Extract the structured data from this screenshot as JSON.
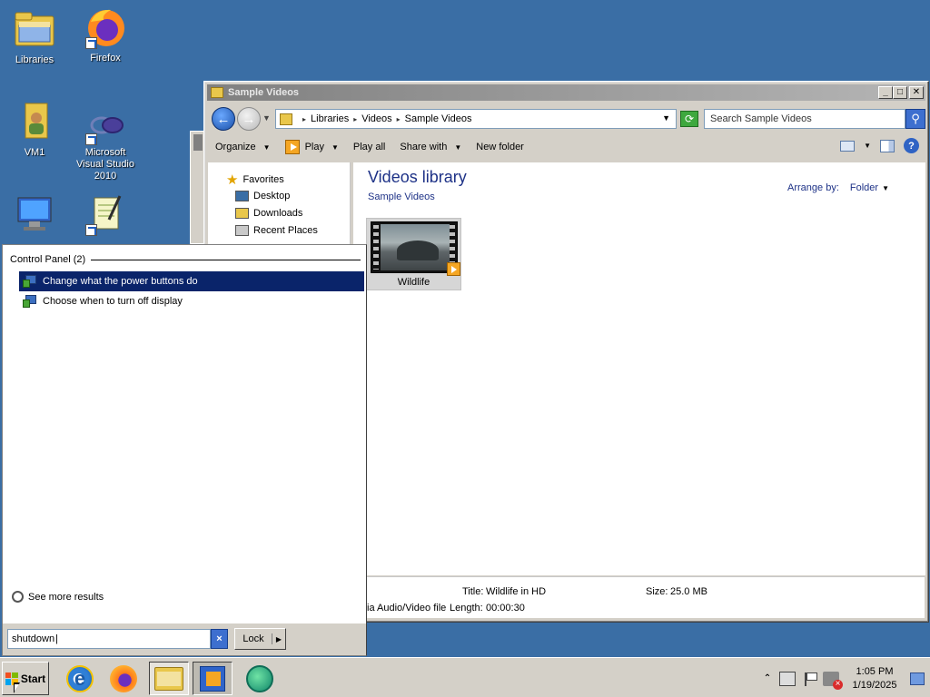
{
  "desktop": {
    "icons": [
      {
        "label": "Libraries",
        "icon": "libraries-folder-icon"
      },
      {
        "label": "Firefox",
        "icon": "firefox-icon"
      },
      {
        "label": "VM1",
        "icon": "user-folder-icon"
      },
      {
        "label": "Microsoft Visual Studio 2010",
        "icon": "visual-studio-icon"
      },
      {
        "label": "Computer",
        "icon": "computer-icon"
      },
      {
        "label": "Notepad",
        "icon": "notepad-icon"
      }
    ]
  },
  "explorer": {
    "title": "Sample Videos",
    "address": {
      "crumbs": [
        "Libraries",
        "Videos",
        "Sample Videos"
      ]
    },
    "search": {
      "placeholder": "Search Sample Videos"
    },
    "commands": {
      "organize": "Organize",
      "play": "Play",
      "play_all": "Play all",
      "share_with": "Share with",
      "new_folder": "New folder"
    },
    "nav": {
      "favorites": "Favorites",
      "items": [
        "Desktop",
        "Downloads",
        "Recent Places"
      ]
    },
    "library": {
      "title": "Videos library",
      "subtitle": "Sample Videos",
      "arrange_label": "Arrange by:",
      "arrange_value": "Folder"
    },
    "items": [
      {
        "name": "Wildlife"
      }
    ],
    "details": {
      "title_label": "Title:",
      "title_value": "Wildlife in HD",
      "size_label": "Size:",
      "size_value": "25.0 MB",
      "type_text": "ia Audio/Video file",
      "length_label": "Length:",
      "length_value": "00:00:30"
    }
  },
  "start_menu": {
    "group_header": "Control Panel (2)",
    "results": [
      {
        "label": "Change what the power buttons do",
        "selected": true
      },
      {
        "label": "Choose when to turn off display",
        "selected": false
      }
    ],
    "see_more": "See more results",
    "search_value": "shutdown",
    "clear_symbol": "×",
    "lock_label": "Lock"
  },
  "taskbar": {
    "start_label": "Start",
    "apps": [
      "internet-explorer",
      "firefox",
      "windows-explorer",
      "windows-media-player",
      "chat-app"
    ],
    "clock": {
      "time": "1:05 PM",
      "date": "1/19/2025"
    }
  },
  "colors": {
    "desktop": "#3a6ea5",
    "selection": "#0a246a",
    "window_face": "#d4d0c8",
    "library_title": "#1e3287"
  }
}
